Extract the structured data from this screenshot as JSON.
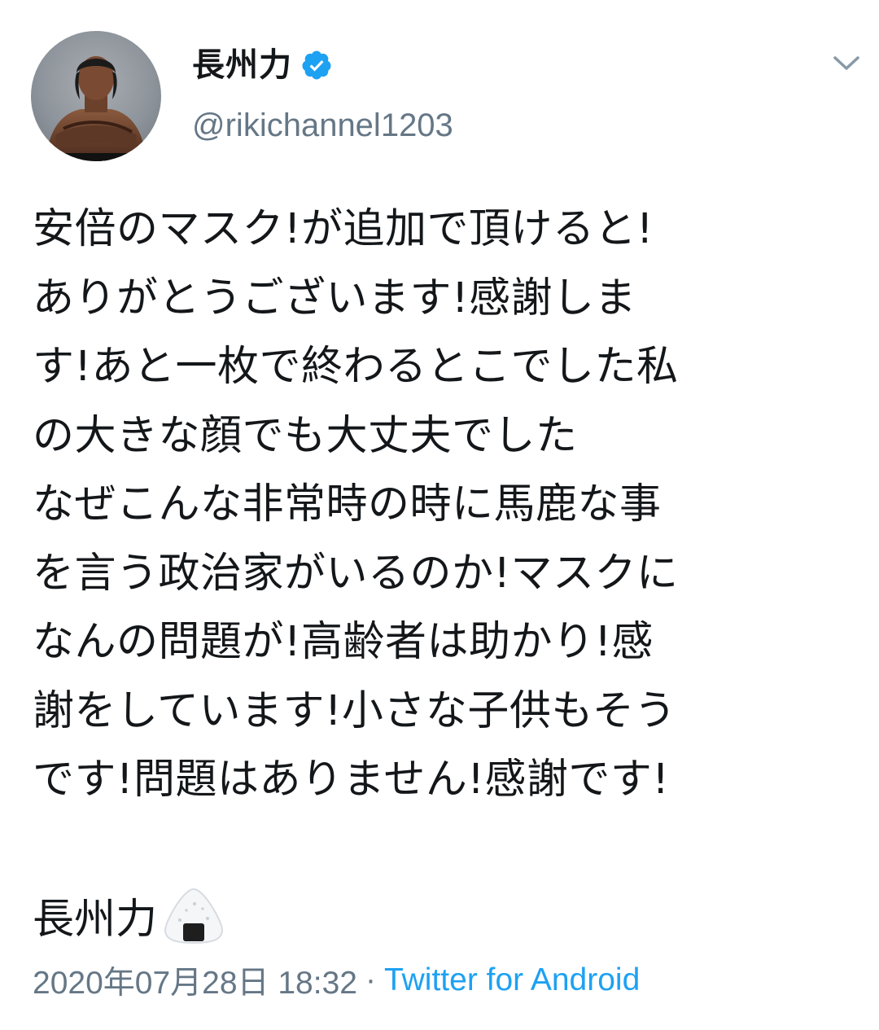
{
  "author": {
    "display_name": "長州力",
    "handle": "@rikichannel1203",
    "verified": true,
    "avatar_icon": "profile-photo-icon"
  },
  "tweet": {
    "text": "安倍のマスク!が追加で頂けると!\nありがとうございます!感謝しま\nす!あと一枚で終わるとこでした私\nの大きな顔でも大丈夫でした\nなぜこんな非常時の時に馬鹿な事\nを言う政治家がいるのか!マスクに\nなんの問題が!高齢者は助かり!感\n謝をしています!小さな子供もそう\nです!問題はありません!感謝です!",
    "signature": "長州力",
    "signature_emoji": "onigiri-icon"
  },
  "meta": {
    "timestamp": "2020年07月28日 18:32",
    "separator": "·",
    "source": "Twitter for Android"
  },
  "colors": {
    "text": "#14171a",
    "secondary": "#657786",
    "accent": "#1da1f2"
  },
  "icons": {
    "verified": "verified-badge-icon",
    "menu": "chevron-down-icon"
  }
}
